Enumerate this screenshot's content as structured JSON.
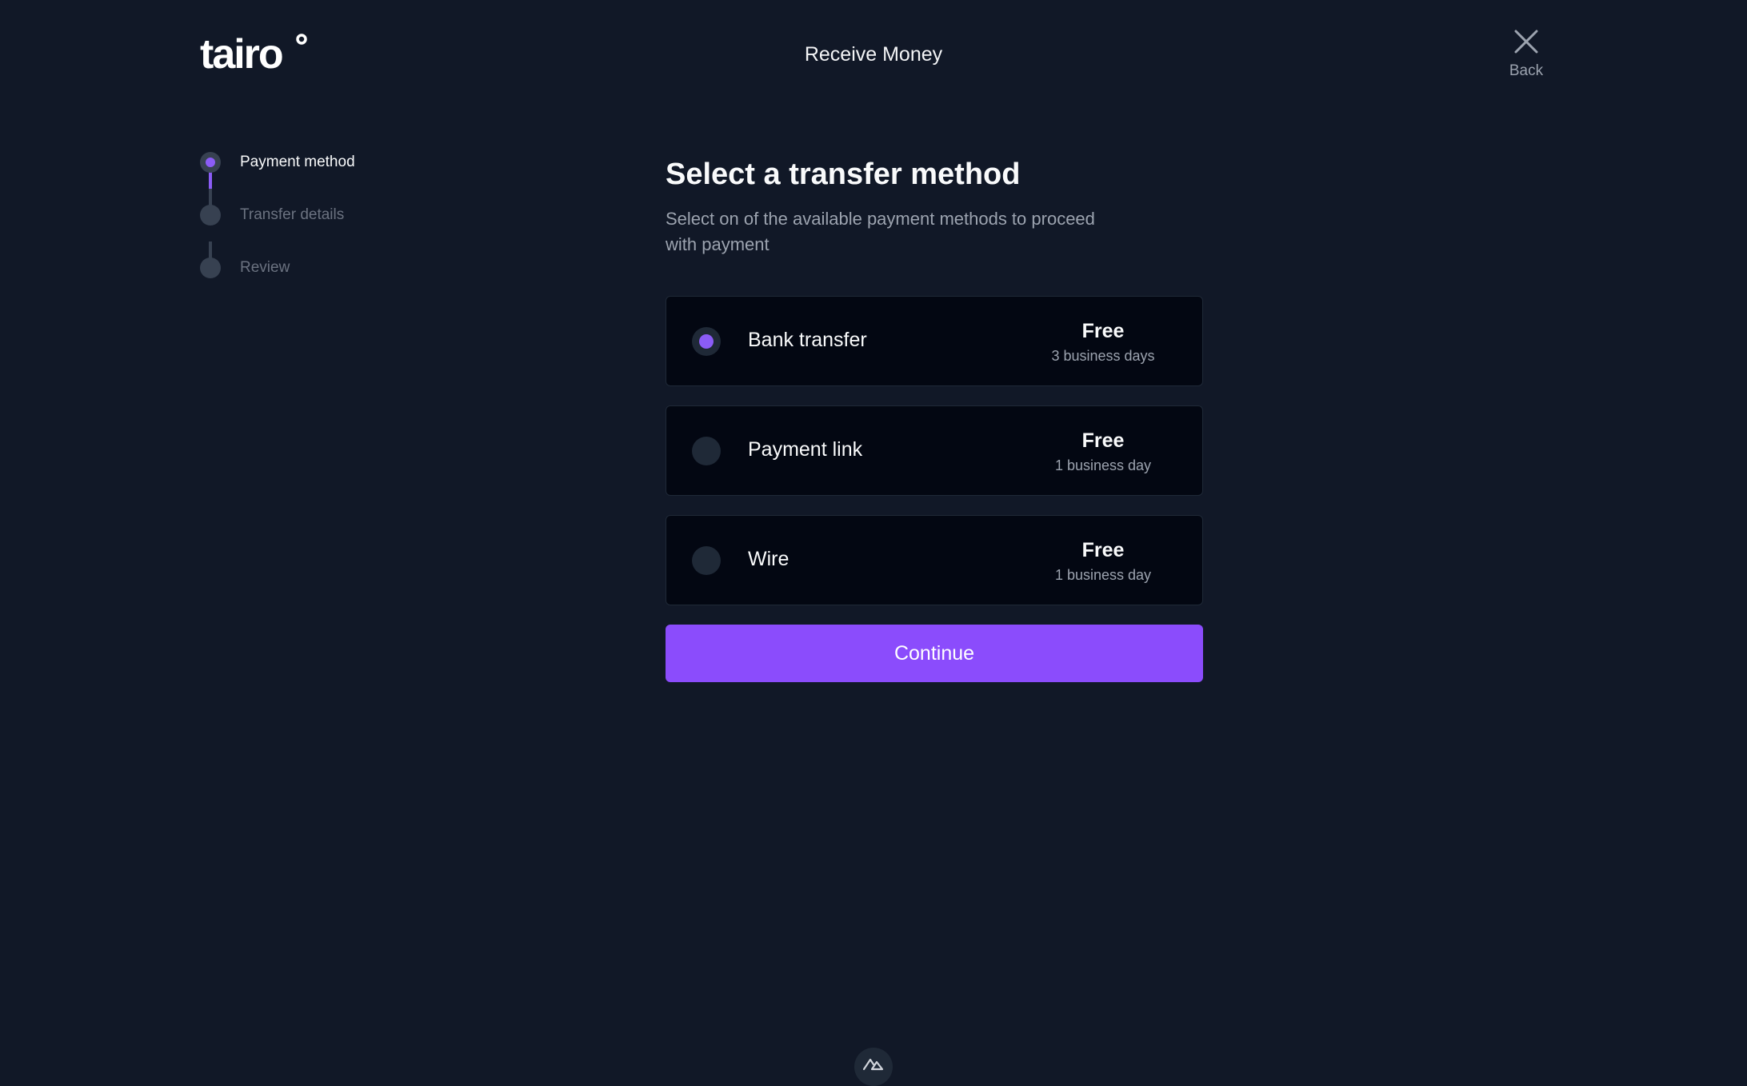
{
  "brand": {
    "name": "tairo"
  },
  "header": {
    "title": "Receive Money",
    "back_label": "Back"
  },
  "stepper": {
    "steps": [
      {
        "label": "Payment method",
        "active": true
      },
      {
        "label": "Transfer details",
        "active": false
      },
      {
        "label": "Review",
        "active": false
      }
    ]
  },
  "main": {
    "heading": "Select a transfer method",
    "subtitle": "Select on of the available payment methods to proceed with payment",
    "options": [
      {
        "name": "Bank transfer",
        "price": "Free",
        "time": "3 business days",
        "selected": true
      },
      {
        "name": "Payment link",
        "price": "Free",
        "time": "1 business day",
        "selected": false
      },
      {
        "name": "Wire",
        "price": "Free",
        "time": "1 business day",
        "selected": false
      }
    ],
    "continue_label": "Continue"
  },
  "colors": {
    "background": "#111827",
    "card": "#030712",
    "accent": "#8b5cf6",
    "muted_text": "#9ca3af"
  }
}
